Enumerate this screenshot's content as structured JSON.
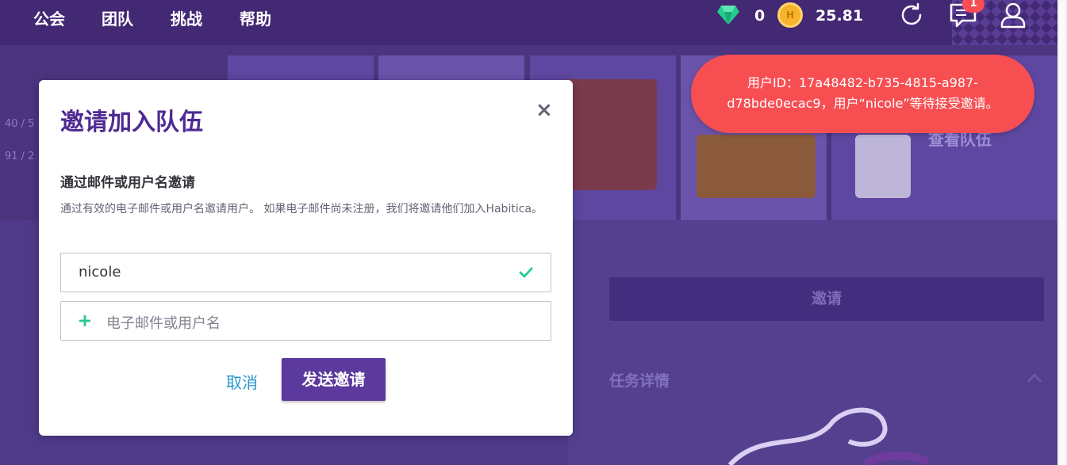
{
  "nav": {
    "items": [
      {
        "label": "公会"
      },
      {
        "label": "团队"
      },
      {
        "label": "挑战"
      },
      {
        "label": "帮助"
      }
    ],
    "gems": "0",
    "gold": "25.81",
    "gold_icon_letter": "H",
    "notification_count": "1"
  },
  "header": {
    "stats": [
      "40 / 5",
      "91 / 2"
    ],
    "view_party_label": "查看队伍"
  },
  "page": {
    "invite_button_label": "邀请",
    "quest_details_label": "任务详情"
  },
  "modal": {
    "title": "邀请加入队伍",
    "close_symbol": "×",
    "section_heading": "通过邮件或用户名邀请",
    "section_description": "通过有效的电子邮件或用户名邀请用户。 如果电子邮件尚未注册，我们将邀请他们加入Habitica。",
    "field_value": "nicole",
    "field_placeholder": "电子邮件或用户名",
    "cancel_label": "取消",
    "send_label": "发送邀请"
  },
  "toast": {
    "message": "用户ID：17a48482-b735-4815-a987-d78bde0ecac9，用户“nicole”等待接受邀请。"
  },
  "colors": {
    "nav_bg": "#432874",
    "modal_title": "#4f2a93",
    "primary_button": "#5c3a9d",
    "link": "#2995cd",
    "toast_bg": "#f74e52",
    "success_check": "#24cc8f"
  }
}
